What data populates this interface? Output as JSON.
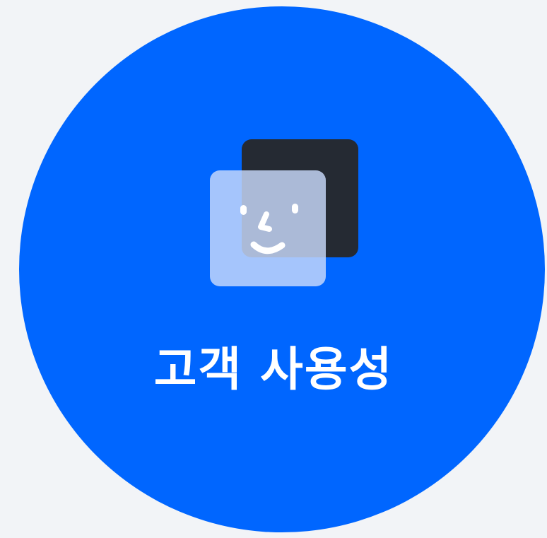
{
  "badge": {
    "label": "고객 사용성",
    "icon": "overlapping-face-cards-icon",
    "colors": {
      "background": "#f2f4f7",
      "circle": "#0066ff",
      "back_card": "#252a33",
      "front_card": "#b3cdfb",
      "text": "#ffffff"
    }
  }
}
